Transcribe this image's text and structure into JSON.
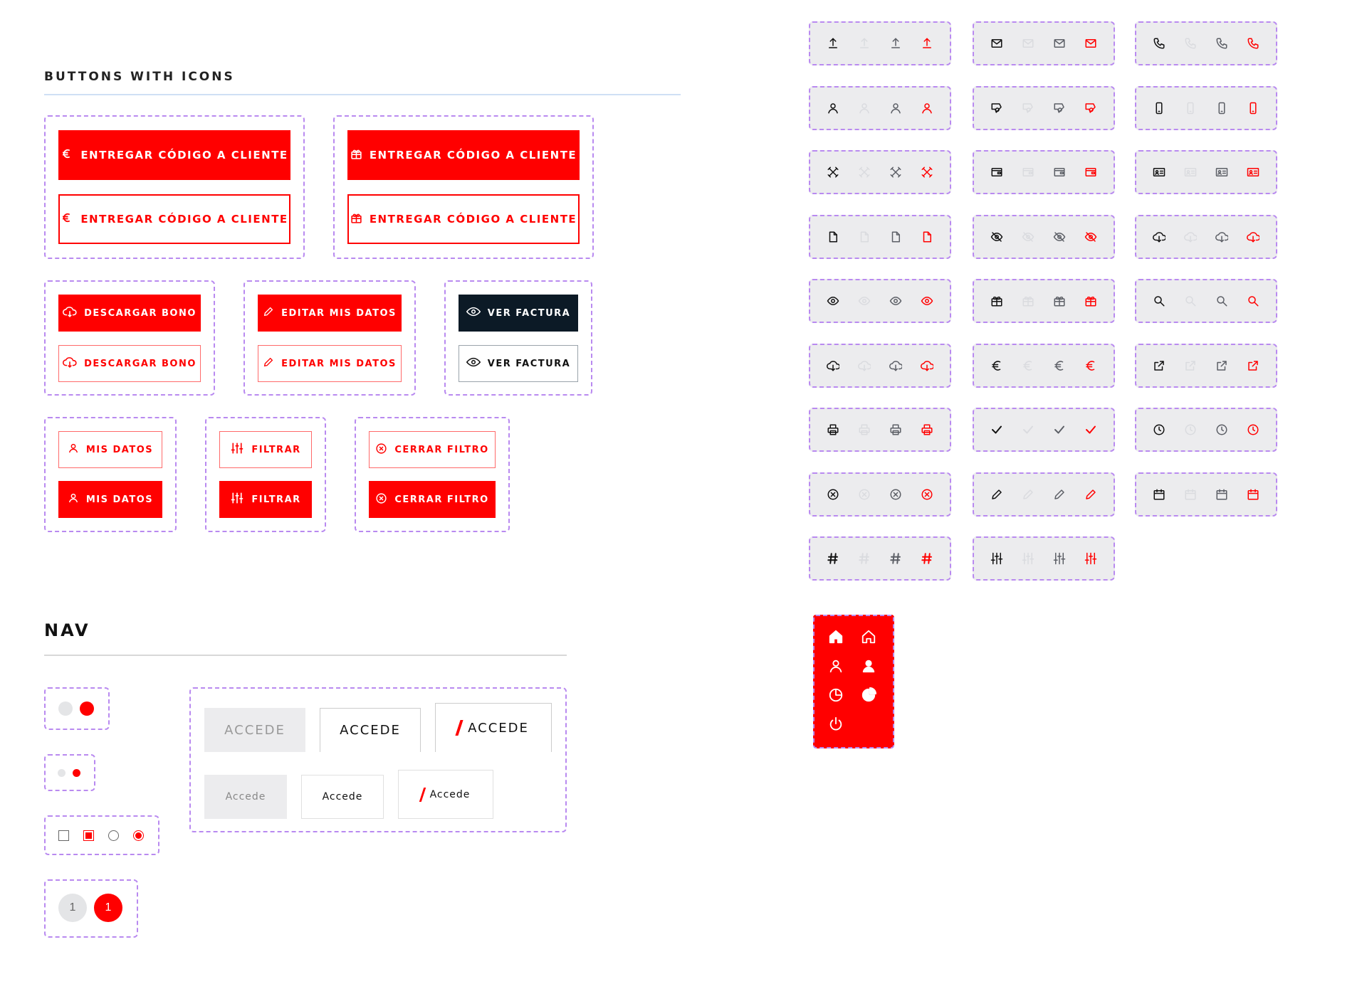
{
  "colors": {
    "accent": "#ff0000",
    "dark": "#0c1a26",
    "dashed": "#b98af0",
    "grey": "#ececee"
  },
  "buttons_section": {
    "title": "BUTTONS WITH ICONS",
    "entregar_label": "ENTREGAR CÓDIGO A CLIENTE",
    "descargar_label": "DESCARGAR BONO",
    "editar_label": "EDITAR MIS DATOS",
    "ver_factura_label": "VER FACTURA",
    "mis_datos_label": "MIS DATOS",
    "filtrar_label": "FILTRAR",
    "cerrar_filtro_label": "CERRAR FILTRO"
  },
  "nav_section": {
    "title": "NAV",
    "accede_upper": "ACCEDE",
    "accede_lower": "Accede",
    "pagination_value": "1"
  },
  "icon_groups": [
    "upload-icon",
    "mail-icon",
    "phone-icon",
    "user-icon",
    "tag-icon",
    "mobile-icon",
    "tools-icon",
    "wallet-icon",
    "id-card-icon",
    "document-icon",
    "eye-off-icon",
    "cloud-download-icon",
    "eye-icon",
    "gift-icon",
    "search-icon",
    "cloud-download-icon",
    "euro-icon",
    "external-link-icon",
    "printer-icon",
    "check-icon",
    "clock-icon",
    "close-circle-icon",
    "pencil-icon",
    "calendar-icon",
    "hash-icon",
    "sliders-icon"
  ],
  "side_nav_icons": [
    "home-icon",
    "home-outline-icon",
    "user-outline-icon",
    "user-filled-icon",
    "pie-outline-icon",
    "pie-filled-icon",
    "power-icon"
  ]
}
